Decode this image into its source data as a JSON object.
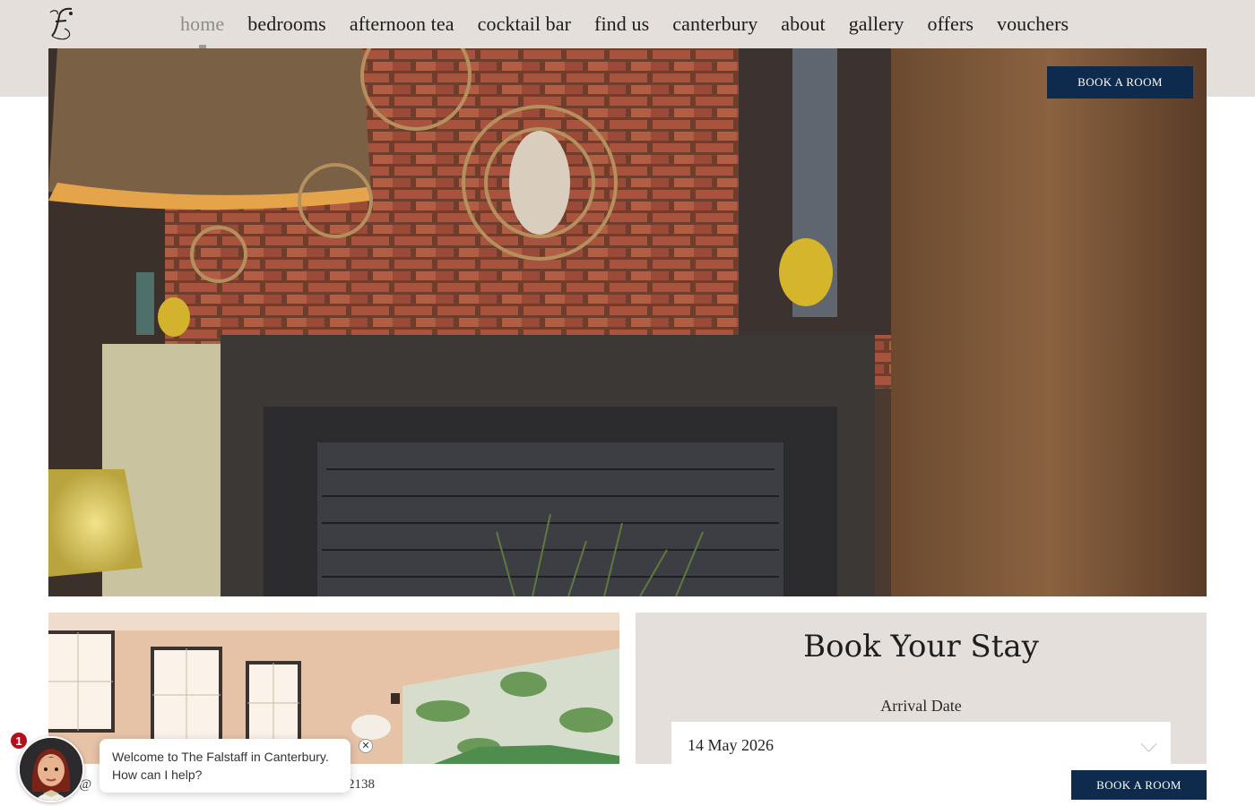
{
  "logo": {
    "letter": "F",
    "icon": "falstaff-crest-logo"
  },
  "nav": {
    "items": [
      "home",
      "bedrooms",
      "afternoon tea",
      "cocktail bar",
      "find us",
      "canterbury",
      "about",
      "gallery",
      "offers",
      "vouchers"
    ],
    "active": "home"
  },
  "hero": {
    "book_button": "BOOK A ROOM"
  },
  "booking": {
    "title": "Book Your Stay",
    "arrival_label": "Arrival Date",
    "arrival_value": "14 May 2026"
  },
  "footer": {
    "contact_fragment": "tay@",
    "phone_fragment": "2138",
    "book_button": "BOOK A ROOM"
  },
  "chat": {
    "badge_count": "1",
    "message_line1": "Welcome to The Falstaff in Canterbury.",
    "message_line2": "How can I help?",
    "close_glyph": "✕"
  },
  "colors": {
    "brand_navy": "#0e2a4c",
    "panel_beige": "#e4dfdb",
    "badge_red": "#b0121b"
  }
}
